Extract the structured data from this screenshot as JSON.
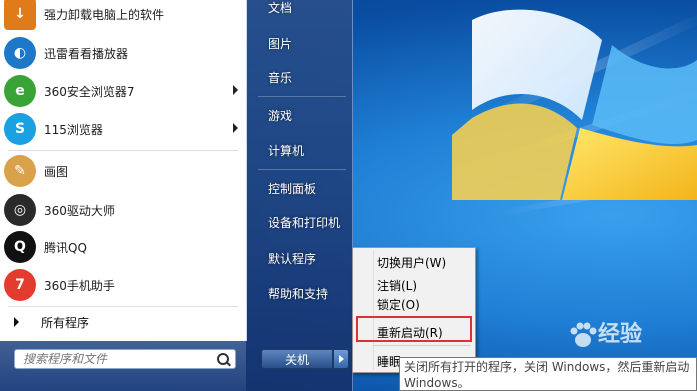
{
  "left_programs": [
    {
      "label": "强力卸载电脑上的软件",
      "icon": "uninstall-box-icon",
      "color": "#e07b1a",
      "submenu": false
    },
    {
      "label": "迅雷看看播放器",
      "icon": "xunlei-player-icon",
      "color": "#1d78c9",
      "submenu": false
    },
    {
      "label": "360安全浏览器7",
      "icon": "browser-360-icon",
      "color": "#3aa335",
      "submenu": true
    },
    {
      "label": "115浏览器",
      "icon": "browser-115-icon",
      "color": "#1ba0e2",
      "submenu": true
    },
    {
      "label": "画图",
      "icon": "paint-palette-icon",
      "color": "#d9a14a",
      "submenu": false
    },
    {
      "label": "360驱动大师",
      "icon": "driver-master-icon",
      "color": "#2a2a2a",
      "submenu": false
    },
    {
      "label": "腾讯QQ",
      "icon": "qq-penguin-icon",
      "color": "#111111",
      "submenu": false
    },
    {
      "label": "360手机助手",
      "icon": "phone-assistant-icon",
      "color": "#e33b2e",
      "submenu": false
    }
  ],
  "all_programs": "所有程序",
  "search": {
    "placeholder": "搜索程序和文件"
  },
  "right_links": [
    {
      "label": "文档"
    },
    {
      "label": "图片"
    },
    {
      "label": "音乐"
    },
    {
      "label": "游戏"
    },
    {
      "label": "计算机"
    },
    {
      "label": "控制面板"
    },
    {
      "label": "设备和打印机"
    },
    {
      "label": "默认程序"
    },
    {
      "label": "帮助和支持"
    }
  ],
  "shutdown": {
    "label": "关机"
  },
  "power_menu": {
    "items": [
      "切换用户(W)",
      "注销(L)",
      "锁定(O)",
      "重新启动(R)",
      "睡眠"
    ]
  },
  "tooltip": {
    "line1": "关闭所有打开的程序，关闭 Windows，然后重新启动",
    "line2": "Windows。"
  },
  "watermark": {
    "text": "经验"
  },
  "colors": {
    "highlight_box": "#e03030",
    "desktop": "#1f7fd4"
  }
}
